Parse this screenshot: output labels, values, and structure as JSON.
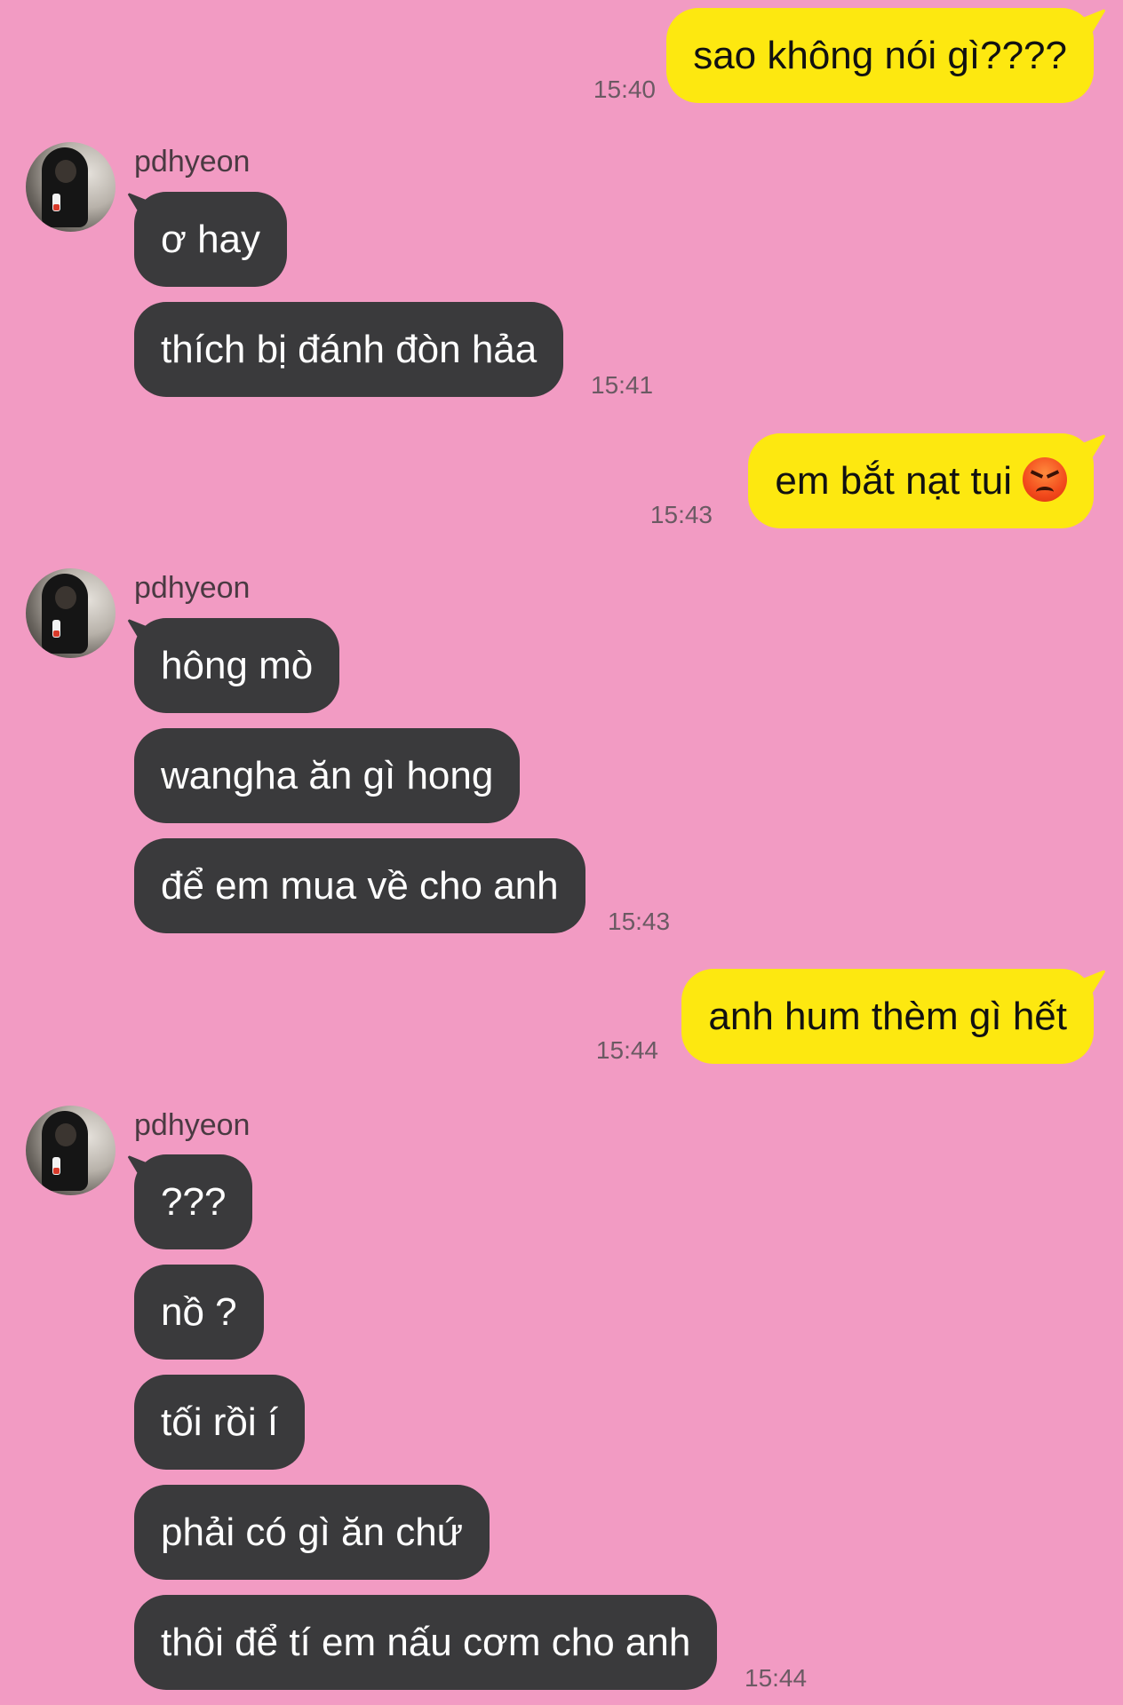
{
  "colors": {
    "background": "#f29bc3",
    "incoming_bubble": "#3a3a3c",
    "outgoing_bubble": "#fde810"
  },
  "messages": [
    {
      "direction": "out",
      "text": "sao không nói gì????",
      "time": "15:40"
    },
    {
      "direction": "in",
      "sender": "pdhyeon",
      "lines": [
        "ơ hay",
        "thích bị đánh đòn hảa"
      ],
      "time": "15:41"
    },
    {
      "direction": "out",
      "text": "em bắt nạt tui",
      "emoji": "angry-face-icon",
      "time": "15:43"
    },
    {
      "direction": "in",
      "sender": "pdhyeon",
      "lines": [
        "hông mò",
        "wangha ăn gì hong",
        "để em mua về cho anh"
      ],
      "time": "15:43"
    },
    {
      "direction": "out",
      "text": "anh hum thèm gì hết",
      "time": "15:44"
    },
    {
      "direction": "in",
      "sender": "pdhyeon",
      "lines": [
        "???",
        "nồ ?",
        "tối rồi í",
        "phải có gì ăn chứ",
        "thôi để tí em nấu cơm cho anh"
      ],
      "time": "15:44"
    }
  ]
}
